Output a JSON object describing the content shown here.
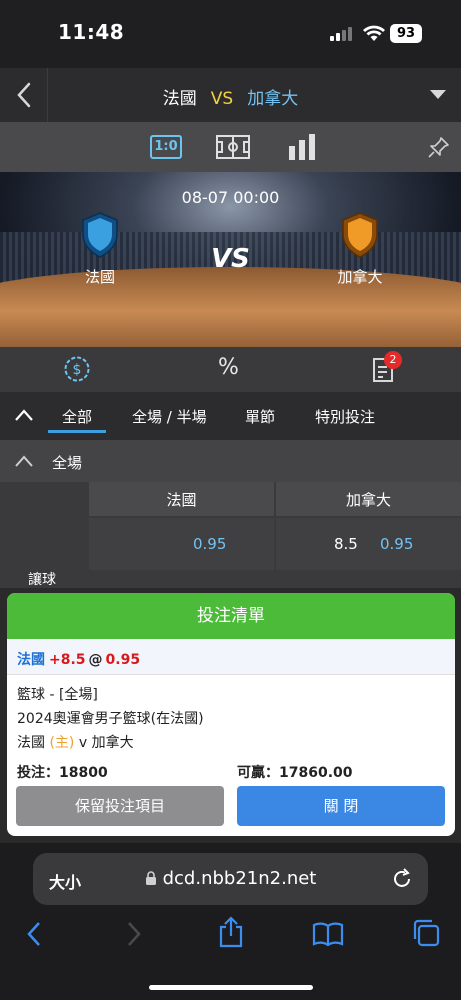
{
  "status": {
    "time": "11:48",
    "battery": "93"
  },
  "header": {
    "home": "法國",
    "vs": "VS",
    "away": "加拿大"
  },
  "toolbar": {
    "score_label": "1:0"
  },
  "banner": {
    "datetime": "08-07 00:00",
    "vs": "VS",
    "home": "法國",
    "away": "加拿大",
    "colors": {
      "home_shield": "#3aa0e0",
      "away_shield": "#f09a28"
    }
  },
  "iconrow": {
    "percent": "%",
    "badge": "2"
  },
  "tabs": [
    {
      "label": "全部"
    },
    {
      "label": "全場 / 半場"
    },
    {
      "label": "單節"
    },
    {
      "label": "特別投注"
    }
  ],
  "section": {
    "label": "全場"
  },
  "table": {
    "headers": [
      "法國",
      "加拿大"
    ],
    "row_label": "讓球",
    "home_odds": "0.95",
    "away_line": "8.5",
    "away_odds": "0.95"
  },
  "betslip": {
    "title": "投注清單",
    "pick_team": "法國",
    "pick_handicap": "+8.5",
    "pick_at": "@",
    "pick_odds": "0.95",
    "sport": "籃球 - [全場]",
    "league": "2024奧運會男子籃球(在法國)",
    "match_home": "法國",
    "match_home_tag": "(主)",
    "match_rest": "v 加拿大",
    "stake_label": "投注：",
    "stake_value": "18800",
    "win_label": "可贏：",
    "win_value": "17860.00",
    "keep_button": "保留投注項目",
    "close_button": "關 閉",
    "colors": {
      "header": "#4dbb3a",
      "keep": "#8e8e90",
      "close": "#3b87e4"
    }
  },
  "browser": {
    "aa": "大小",
    "url": "dcd.nbb21n2.net"
  }
}
